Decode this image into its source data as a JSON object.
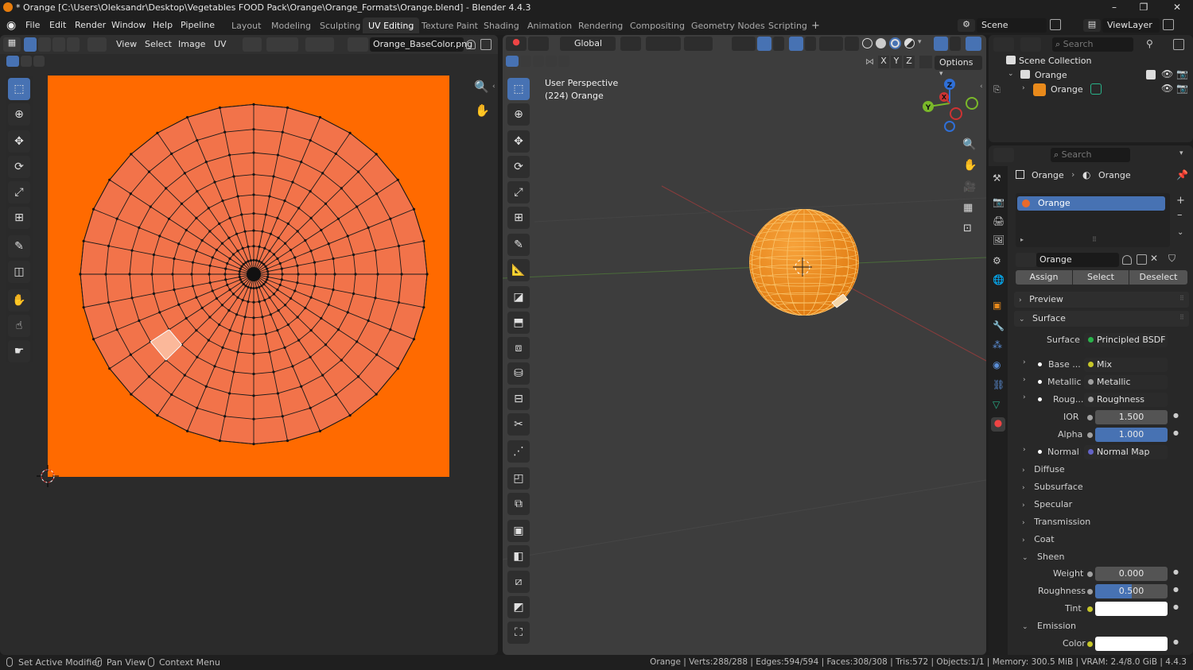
{
  "window": {
    "title": "* Orange [C:\\Users\\Oleksandr\\Desktop\\Vegetables FOOD Pack\\Orange\\Orange_Formats\\Orange.blend] - Blender 4.4.3"
  },
  "menubar": {
    "menus": [
      "File",
      "Edit",
      "Render",
      "Window",
      "Help",
      "Pipeline"
    ],
    "workspaces": [
      "Layout",
      "Modeling",
      "Sculpting",
      "UV Editing",
      "Texture Paint",
      "Shading",
      "Animation",
      "Rendering",
      "Compositing",
      "Geometry Nodes",
      "Scripting"
    ],
    "active_workspace": "UV Editing",
    "scene": "Scene",
    "view_layer": "ViewLayer"
  },
  "uv_editor": {
    "menus": [
      "View",
      "Select",
      "Image",
      "UV"
    ],
    "image_name": "Orange_BaseColor.png",
    "texture_color": "#ff6a00",
    "island_color": "#f2734a"
  },
  "viewport": {
    "transform_orientation": "Global",
    "overlay_line1": "User Perspective",
    "overlay_line2": "(224) Orange",
    "axes": [
      "X",
      "Y",
      "Z"
    ],
    "options_label": "Options",
    "gizmo_labels": {
      "z": "Z",
      "y": "Y",
      "x": "X"
    },
    "orange_color": "#f28a16"
  },
  "outliner": {
    "search_placeholder": "Search",
    "root": "Scene Collection",
    "collection": "Orange",
    "object": "Orange"
  },
  "properties": {
    "search_placeholder": "Search",
    "breadcrumb": [
      "Orange",
      "Orange"
    ],
    "material_slot": "Orange",
    "material_name": "Orange",
    "buttons": [
      "Assign",
      "Select",
      "Deselect"
    ],
    "panels": {
      "preview": "Preview",
      "surface": "Surface"
    },
    "surface": {
      "label": "Surface",
      "shader": "Principled BSDF",
      "rows": [
        {
          "label": "Base ...",
          "value": "Mix",
          "socket": "#c7c729"
        },
        {
          "label": "Metallic",
          "value": "Metallic",
          "socket": "#a1a1a1"
        },
        {
          "label": "Roug...",
          "value": "Roughness",
          "socket": "#a1a1a1"
        }
      ],
      "ior_label": "IOR",
      "ior_value": "1.500",
      "alpha_label": "Alpha",
      "alpha_value": "1.000",
      "normal_label": "Normal",
      "normal_value": "Normal Map",
      "subpanels": [
        "Diffuse",
        "Subsurface",
        "Specular",
        "Transmission",
        "Coat"
      ],
      "sheen_label": "Sheen",
      "sheen_weight_label": "Weight",
      "sheen_weight_value": "0.000",
      "sheen_roughness_label": "Roughness",
      "sheen_roughness_value": "0.500",
      "sheen_roughness_fraction": 0.5,
      "sheen_tint_label": "Tint",
      "emission_label": "Emission",
      "emission_color_label": "Color"
    }
  },
  "statusbar": {
    "left": [
      "Set Active Modifier",
      "Pan View",
      "Context Menu"
    ],
    "right": "Orange | Verts:288/288 | Edges:594/594 | Faces:308/308 | Tris:572 | Objects:1/1 | Memory: 300.5 MiB | VRAM: 2.4/8.0 GiB | 4.4.3"
  }
}
